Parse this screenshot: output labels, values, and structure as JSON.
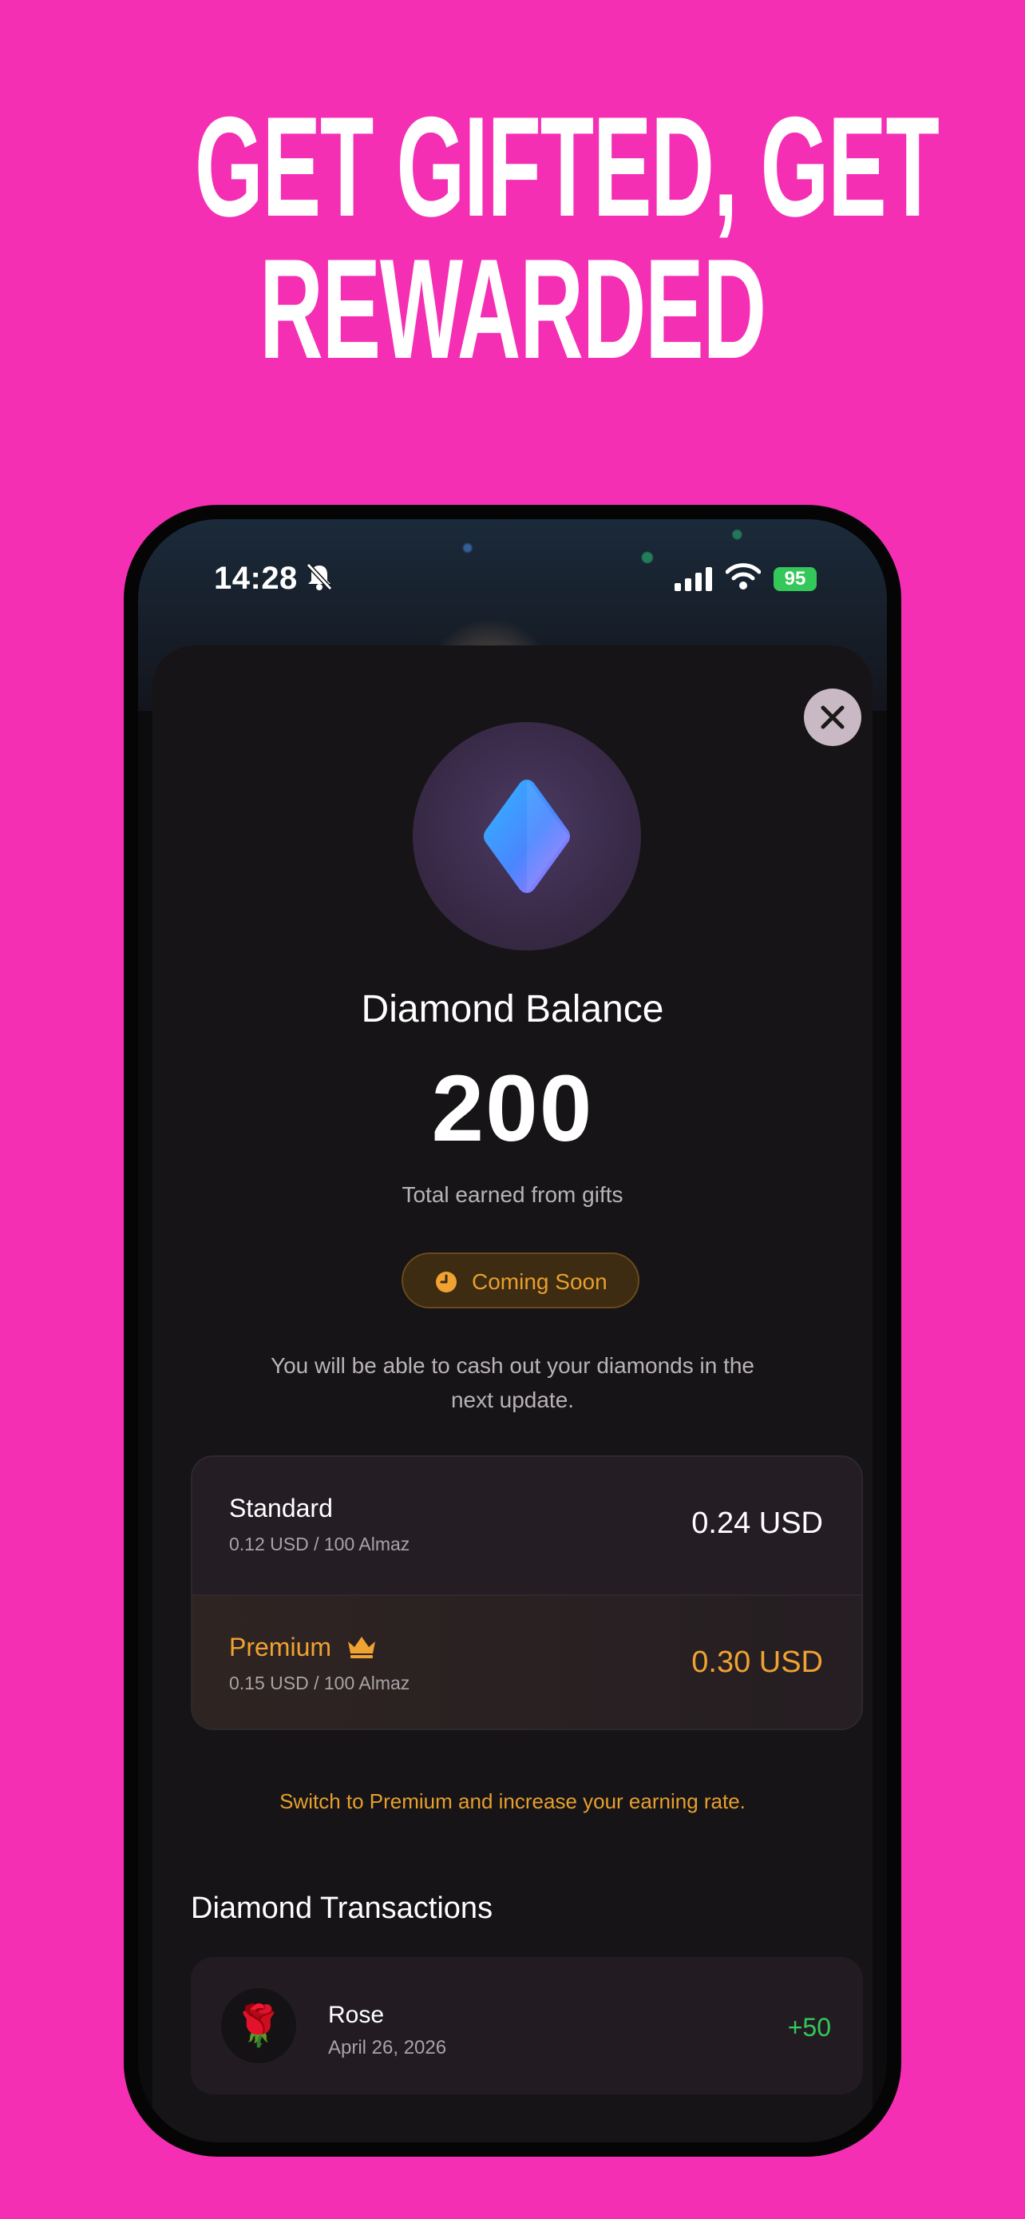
{
  "headline": {
    "line1": "GET GIFTED, GET",
    "line2": "REWARDED"
  },
  "status_bar": {
    "time": "14:28",
    "battery": "95",
    "icons": [
      "bell-slash-icon",
      "signal-icon",
      "wifi-icon",
      "battery-charging-icon"
    ]
  },
  "sheet": {
    "close_icon": "close-icon",
    "diamond_icon": "diamond-icon",
    "balance_title": "Diamond Balance",
    "balance_value": "200",
    "balance_subtitle": "Total earned from gifts",
    "coming_soon_label": "Coming Soon",
    "cashout_note": "You will be able to cash out your diamonds in the next update.",
    "rates": [
      {
        "name": "Standard",
        "detail": "0.12 USD / 100 Almaz",
        "amount": "0.24 USD"
      },
      {
        "name": "Premium",
        "detail": "0.15 USD / 100 Almaz",
        "amount": "0.30 USD",
        "icon": "crown-icon"
      }
    ],
    "premium_note": "Switch to Premium and increase your earning rate.",
    "transactions_heading": "Diamond Transactions",
    "transactions": [
      {
        "icon": "🌹",
        "name": "Rose",
        "date": "April 26, 2026",
        "amount": "+50"
      }
    ]
  },
  "colors": {
    "background": "#f52fb4",
    "accent_orange": "#f0a232",
    "positive_green": "#34c759",
    "sheet": "#161416"
  }
}
